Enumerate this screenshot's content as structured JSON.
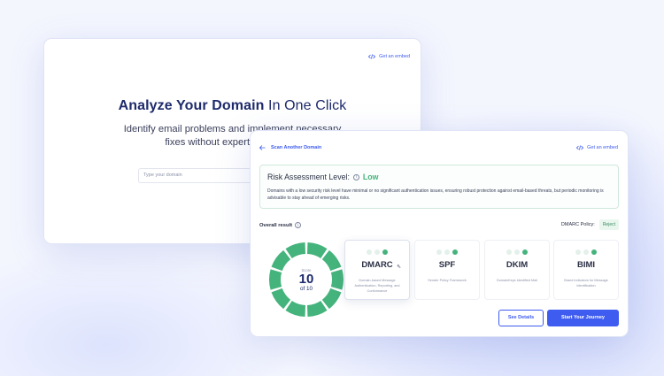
{
  "back_card": {
    "embed_label": "Get an embed",
    "headline_bold": "Analyze Your Domain",
    "headline_rest": " In One Click",
    "subtitle_line1": "Identify email problems and implement necessary",
    "subtitle_line2": "fixes without expert knowledge",
    "domain_placeholder": "Type your domain"
  },
  "front_card": {
    "back_link": "Scan Another Domain",
    "embed_label": "Get an embed",
    "risk": {
      "title": "Risk Assessment Level:",
      "level": "Low",
      "description": "Domains with a low security risk level have minimal or no significant authentication issues, ensuring robust protection against email-based threats, but periodic monitoring is advisable to stay ahead of emerging risks."
    },
    "overall_label": "Overall result",
    "policy_label": "DMARC Policy:",
    "policy_value": "Reject",
    "score": {
      "label": "Score",
      "value": "10",
      "of": "of 10",
      "segments_filled": 10,
      "segments_total": 10
    },
    "protocols": [
      {
        "name": "DMARC",
        "desc": "Domain-based Message Authentication, Reporting, and Conformance",
        "active": true
      },
      {
        "name": "SPF",
        "desc": "Sender Policy Framework",
        "active": false
      },
      {
        "name": "DKIM",
        "desc": "DomainKeys Identified Mail",
        "active": false
      },
      {
        "name": "BIMI",
        "desc": "Brand Indicators for Message Identification",
        "active": false
      }
    ],
    "see_details": "See Details",
    "start_journey": "Start Your Journey"
  },
  "colors": {
    "accent": "#3e5cf0",
    "success": "#45b37c",
    "navy": "#1e2a6b"
  }
}
